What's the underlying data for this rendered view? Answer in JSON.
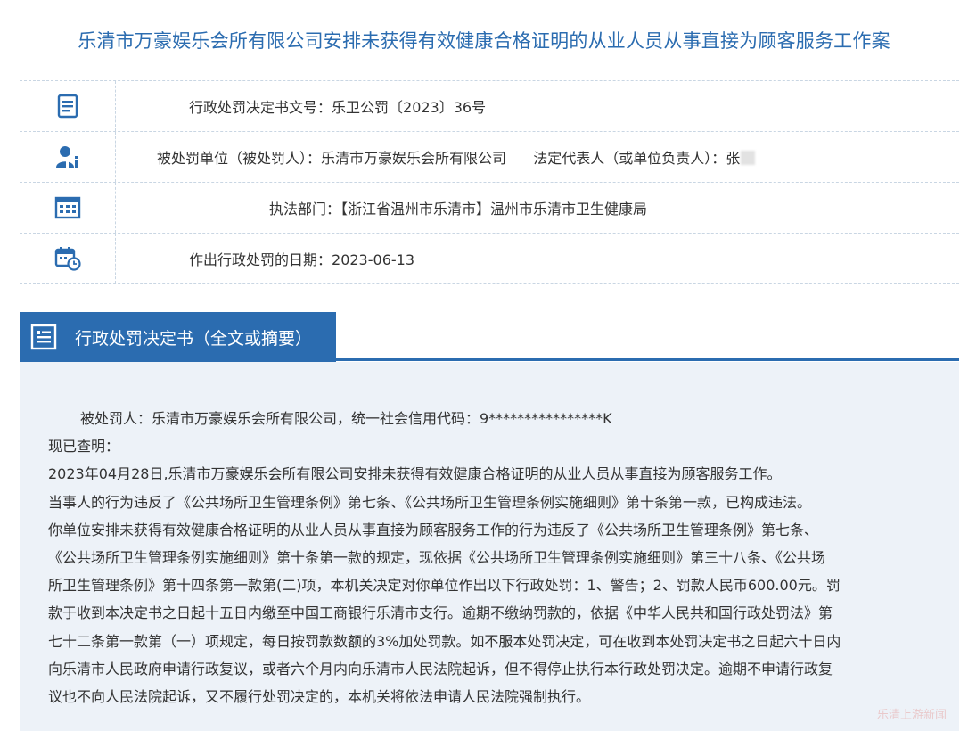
{
  "title": "乐清市万豪娱乐会所有限公司安排未获得有效健康合格证明的从业人员从事直接为顾客服务工作案",
  "info": {
    "doc_number": {
      "label": "行政处罚决定书文号：",
      "value": "乐卫公罚〔2023〕36号",
      "icon": "document-list-icon"
    },
    "punished_party": {
      "label": "被处罚单位（被处罚人）：",
      "value": "乐清市万豪娱乐会所有限公司",
      "rep_label": "法定代表人（或单位负责人）：",
      "rep_value": "张",
      "icon": "person-icon"
    },
    "department": {
      "label": "执法部门：",
      "value": "【浙江省温州市乐清市】温州市乐清市卫生健康局",
      "icon": "building-icon"
    },
    "date": {
      "label": "作出行政处罚的日期：",
      "value": "2023-06-13",
      "icon": "calendar-clock-icon"
    }
  },
  "section": {
    "title": "行政处罚决定书（全文或摘要）",
    "icon": "document-icon"
  },
  "content": {
    "line1": "被处罚人：乐清市万豪娱乐会所有限公司，统一社会信用代码：9****************K",
    "line2": "现已查明：",
    "line3": "2023年04月28日,乐清市万豪娱乐会所有限公司安排未获得有效健康合格证明的从业人员从事直接为顾客服务工作。",
    "line4": "当事人的行为违反了《公共场所卫生管理条例》第七条、《公共场所卫生管理条例实施细则》第十条第一款，已构成违法。",
    "para": [
      "你单位安排未获得有效健康合格证明的从业人员从事直接为顾客服务工作的行为违反了《公共场所卫生管理条例》第七条、",
      "《公共场所卫生管理条例实施细则》第十条第一款的规定，现依据《公共场所卫生管理条例实施细则》第三十八条、《公共场",
      "所卫生管理条例》第十四条第一款第(二)项，本机关决定对你单位作出以下行政处罚：1、警告；2、罚款人民币600.00元。罚",
      "款于收到本决定书之日起十五日内缴至中国工商银行乐清市支行。逾期不缴纳罚款的，依据《中华人民共和国行政处罚法》第",
      "七十二条第一款第（一）项规定，每日按罚款数额的3%加处罚款。如不服本处罚决定，可在收到本处罚决定书之日起六十日内",
      "向乐清市人民政府申请行政复议，或者六个月内向乐清市人民法院起诉，但不得停止执行本行政处罚决定。逾期不申请行政复",
      "议也不向人民法院起诉，又不履行处罚决定的，本机关将依法申请人民法院强制执行。"
    ]
  },
  "watermark": "乐清上游新闻",
  "colors": {
    "accent": "#2b6cb0",
    "content_bg": "#edf2f8",
    "divider": "#c9d6e3"
  }
}
